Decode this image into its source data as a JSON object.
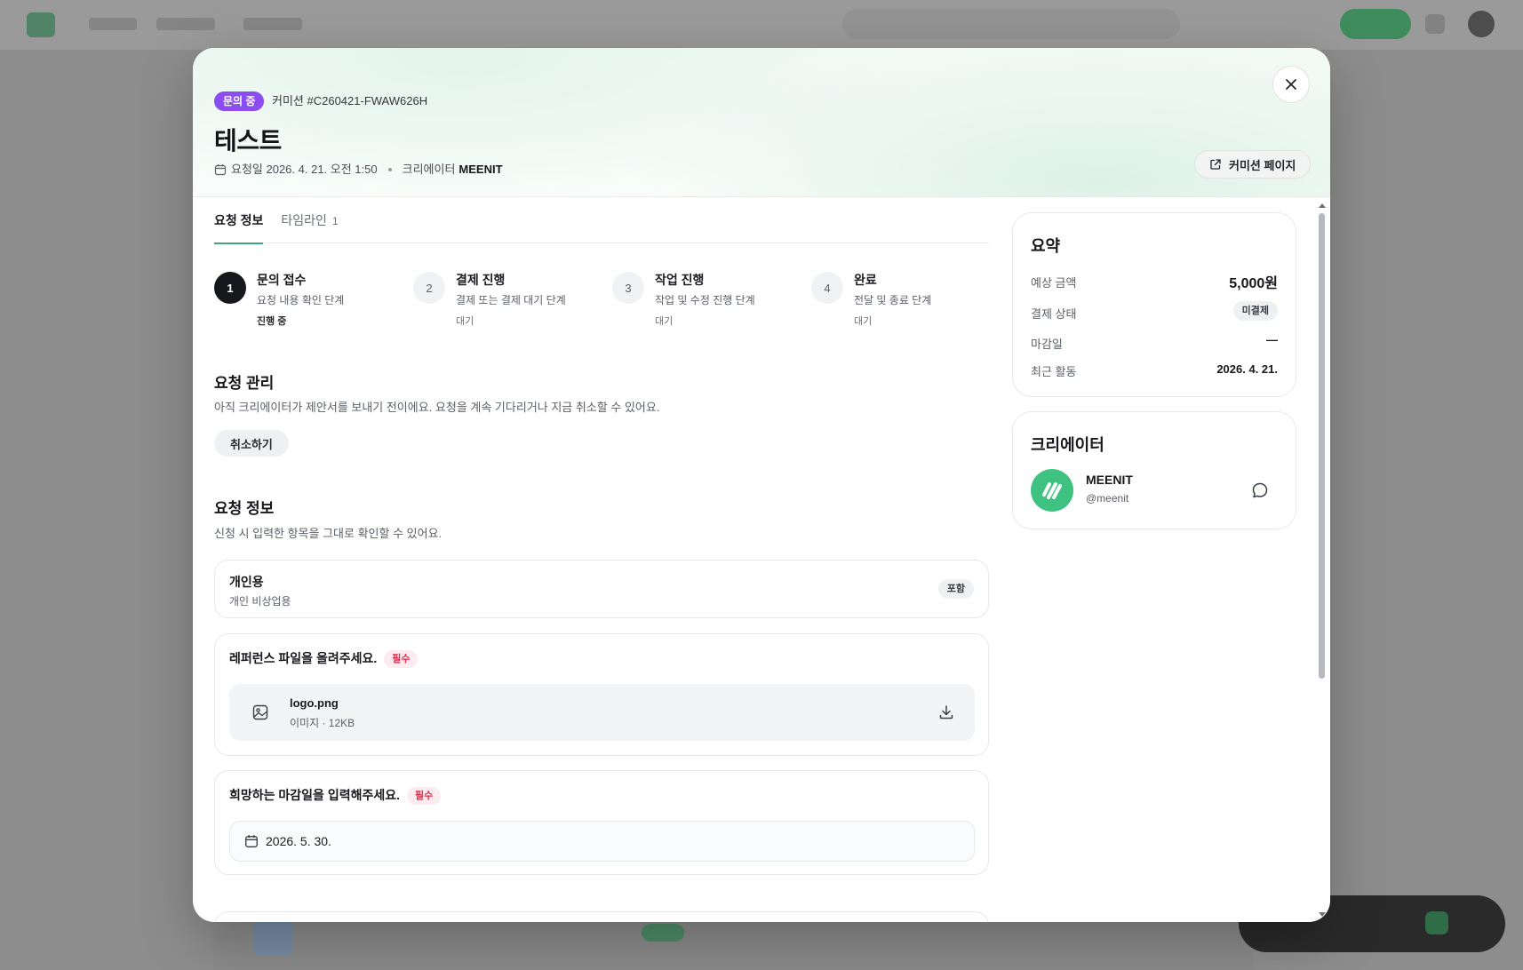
{
  "modal": {
    "status": "문의 중",
    "code": "커미션 #C260421-FWAW626H",
    "title": "테스트",
    "request_date": "요청일 2026. 4. 21. 오전 1:50",
    "creator_label": "크리에이터",
    "creator_name": "MEENIT",
    "page_button": "커미션 페이지"
  },
  "tabs": [
    {
      "label": "요청 정보",
      "count": ""
    },
    {
      "label": "타임라인",
      "count": "1"
    }
  ],
  "steps": [
    {
      "num": "1",
      "title": "문의 접수",
      "desc": "요청 내용 확인 단계",
      "state": "진행 중"
    },
    {
      "num": "2",
      "title": "결제 진행",
      "desc": "결제 또는 결제 대기 단계",
      "state": "대기"
    },
    {
      "num": "3",
      "title": "작업 진행",
      "desc": "작업 및 수정 진행 단계",
      "state": "대기"
    },
    {
      "num": "4",
      "title": "완료",
      "desc": "전달 및 종료 단계",
      "state": "대기"
    }
  ],
  "manage": {
    "title": "요청 관리",
    "desc": "아직 크리에이터가 제안서를 보내기 전이에요. 요청을 계속 기다리거나 지금 취소할 수 있어요.",
    "cancel": "취소하기"
  },
  "info": {
    "title": "요청 정보",
    "desc": "신청 시 입력한 항목을 그대로 확인할 수 있어요."
  },
  "usage": {
    "title": "개인용",
    "sub": "개인 비상업용",
    "badge": "포함"
  },
  "reference": {
    "title": "레퍼런스 파일을 올려주세요.",
    "required": "필수",
    "file_name": "logo.png",
    "file_type": "이미지",
    "file_size": "12KB"
  },
  "deadline": {
    "title": "희망하는 마감일을 입력해주세요.",
    "required": "필수",
    "value": "2026. 5. 30."
  },
  "summary": {
    "title": "요약",
    "rows": [
      {
        "label": "예상 금액",
        "value": "5,000원"
      },
      {
        "label": "결제 상태",
        "value": "미결제"
      },
      {
        "label": "마감일",
        "value": "—"
      },
      {
        "label": "최근 활동",
        "value": "2026. 4. 21."
      }
    ]
  },
  "creator": {
    "title": "크리에이터",
    "name": "MEENIT",
    "handle": "@meenit"
  },
  "colors": {
    "accent": "#3fa77a",
    "status": "#8b4cf0",
    "required": "#e0294b",
    "avatar": "#3ec181"
  }
}
